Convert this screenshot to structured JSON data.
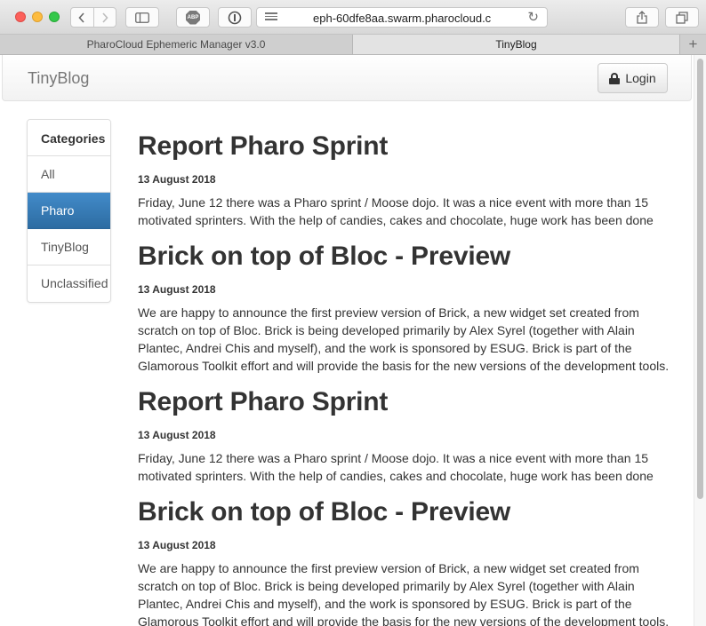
{
  "browser": {
    "url": "eph-60dfe8aa.swarm.pharocloud.c",
    "abp_label": "ABP",
    "tabs": [
      {
        "label": "PharoCloud Ephemeric Manager v3.0"
      },
      {
        "label": "TinyBlog"
      }
    ]
  },
  "navbar": {
    "brand": "TinyBlog",
    "login_label": "Login"
  },
  "sidebar": {
    "title": "Categories",
    "items": [
      {
        "label": "All"
      },
      {
        "label": "Pharo"
      },
      {
        "label": "TinyBlog"
      },
      {
        "label": "Unclassified"
      }
    ],
    "active": "Pharo"
  },
  "posts": [
    {
      "title": "Report Pharo Sprint",
      "date": "13 August 2018",
      "body": "Friday, June 12 there was a Pharo sprint / Moose dojo. It was a nice event with more than 15 motivated sprinters. With the help of candies, cakes and chocolate, huge work has been done"
    },
    {
      "title": "Brick on top of Bloc - Preview",
      "date": "13 August 2018",
      "body": "We are happy to announce the first preview version of Brick, a new widget set created from scratch on top of Bloc. Brick is being developed primarily by Alex Syrel (together with Alain Plantec, Andrei Chis and myself), and the work is sponsored by ESUG. Brick is part of the Glamorous Toolkit effort and will provide the basis for the new versions of the development tools."
    },
    {
      "title": "Report Pharo Sprint",
      "date": "13 August 2018",
      "body": "Friday, June 12 there was a Pharo sprint / Moose dojo. It was a nice event with more than 15 motivated sprinters. With the help of candies, cakes and chocolate, huge work has been done"
    },
    {
      "title": "Brick on top of Bloc - Preview",
      "date": "13 August 2018",
      "body": "We are happy to announce the first preview version of Brick, a new widget set created from scratch on top of Bloc. Brick is being developed primarily by Alex Syrel (together with Alain Plantec, Andrei Chis and myself), and the work is sponsored by ESUG. Brick is part of the Glamorous Toolkit effort and will provide the basis for the new versions of the development tools."
    }
  ],
  "colors": {
    "active_item": "#428bca",
    "close": "#fc605b",
    "minimize": "#fdbc40",
    "zoom": "#34c84a"
  }
}
